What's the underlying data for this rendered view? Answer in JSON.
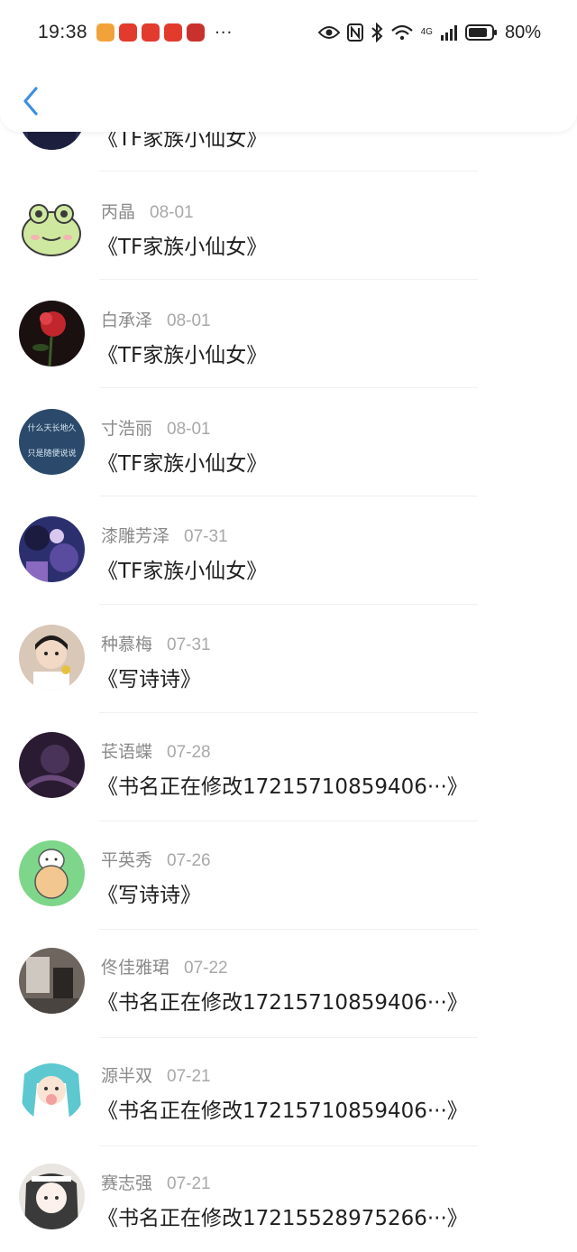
{
  "status": {
    "time": "19:38",
    "more": "···",
    "battery": "80%",
    "network": "4G"
  },
  "header": {
    "back_icon": "chevron-left-icon",
    "accent": "#3d8fe0"
  },
  "items": [
    {
      "name": "",
      "date": "",
      "title": "《TF家族小仙女》",
      "avatar_color": "#2a2f55"
    },
    {
      "name": "丙晶",
      "date": "08-01",
      "title": "《TF家族小仙女》",
      "avatar_color": "#cfe8a0"
    },
    {
      "name": "白承泽",
      "date": "08-01",
      "title": "《TF家族小仙女》",
      "avatar_color": "#3a1414"
    },
    {
      "name": "寸浩丽",
      "date": "08-01",
      "title": "《TF家族小仙女》",
      "avatar_color": "#2b4a6b",
      "avatar_text_1": "什么天长地久",
      "avatar_text_2": "只是随便说说"
    },
    {
      "name": "漆雕芳泽",
      "date": "07-31",
      "title": "《TF家族小仙女》",
      "avatar_color": "#2c2f6e"
    },
    {
      "name": "种慕梅",
      "date": "07-31",
      "title": "《写诗诗》",
      "avatar_color": "#d9c7b8"
    },
    {
      "name": "苌语蝶",
      "date": "07-28",
      "title": "《书名正在修改17215710859406···》",
      "avatar_color": "#2a1b33"
    },
    {
      "name": "平英秀",
      "date": "07-26",
      "title": "《写诗诗》",
      "avatar_color": "#7ed68a"
    },
    {
      "name": "佟佳雅珺",
      "date": "07-22",
      "title": "《书名正在修改17215710859406···》",
      "avatar_color": "#6d655e"
    },
    {
      "name": "源半双",
      "date": "07-21",
      "title": "《书名正在修改17215710859406···》",
      "avatar_color": "#8fd3d8"
    },
    {
      "name": "赛志强",
      "date": "07-21",
      "title": "《书名正在修改17215528975266···》",
      "avatar_color": "#e9e6e2"
    }
  ]
}
